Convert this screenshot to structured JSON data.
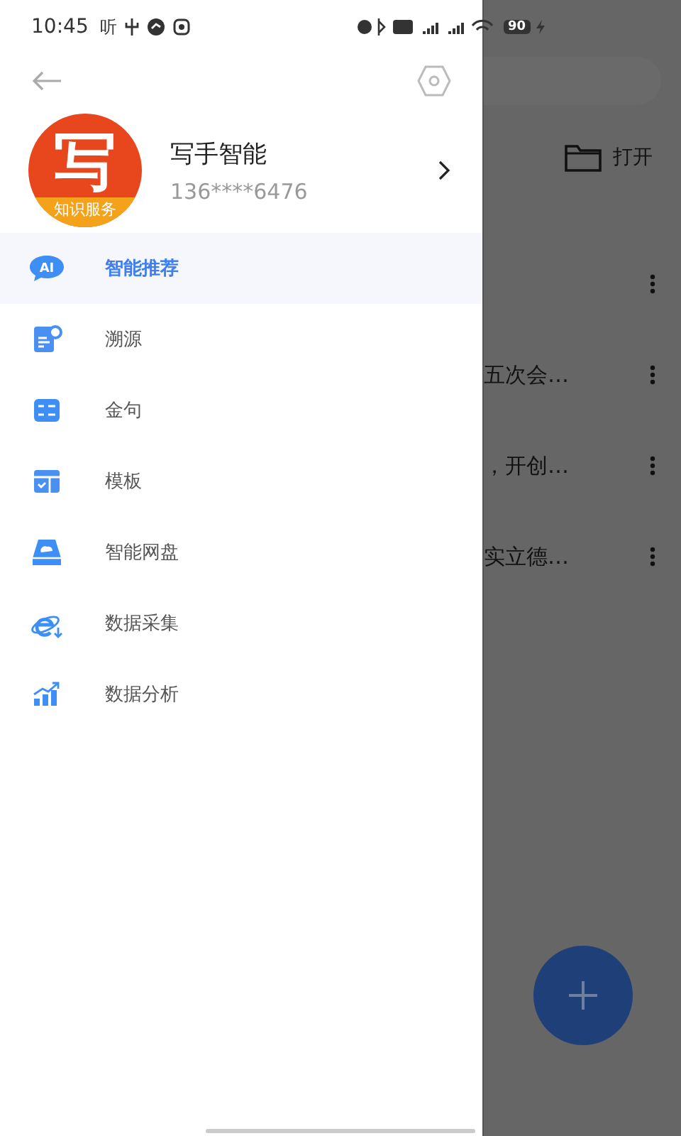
{
  "status_bar": {
    "time": "10:45",
    "app_glyph": "听",
    "battery": "90"
  },
  "drawer": {
    "profile": {
      "logo_text": "写",
      "logo_caption": "知识服务",
      "name": "写手智能",
      "phone": "136****6476"
    },
    "items": [
      {
        "label": "智能推荐",
        "kind": "ai",
        "icon_text": "AI",
        "selected": true
      },
      {
        "label": "溯源",
        "kind": "trace",
        "selected": false
      },
      {
        "label": "金句",
        "kind": "quote",
        "selected": false
      },
      {
        "label": "模板",
        "kind": "template",
        "selected": false
      },
      {
        "label": "智能网盘",
        "kind": "disk",
        "selected": false
      },
      {
        "label": "数据采集",
        "kind": "collect",
        "selected": false
      },
      {
        "label": "数据分析",
        "kind": "analysis",
        "selected": false
      }
    ]
  },
  "background": {
    "open_label": "打开",
    "rows": [
      {},
      {
        "text": "五次会…"
      },
      {
        "text": "，开创…"
      },
      {
        "text": "实立德…"
      }
    ]
  }
}
